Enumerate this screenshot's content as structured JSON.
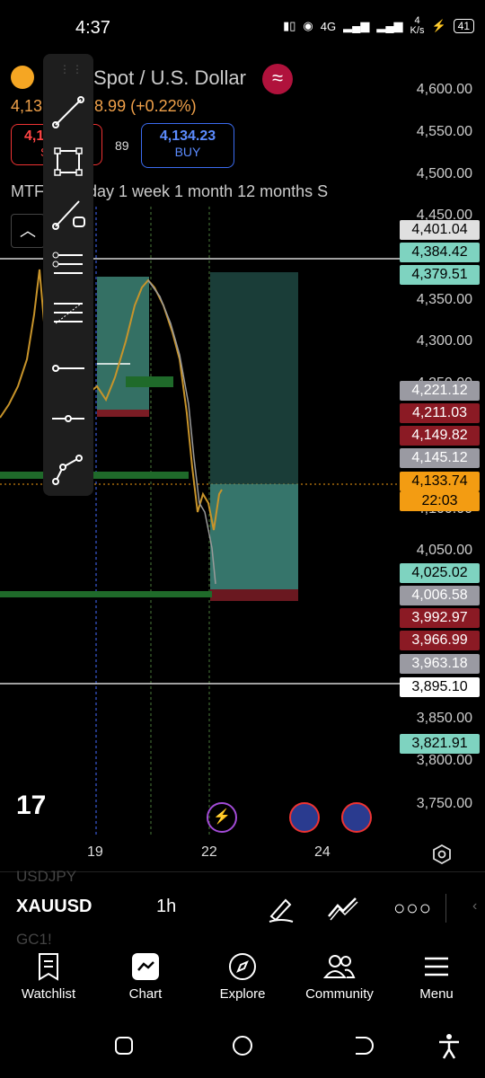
{
  "status": {
    "time": "4:37",
    "net_label": "4G",
    "speed": "4",
    "speed_unit": "K/s",
    "battery": "41"
  },
  "header": {
    "title": "Spot / U.S. Dollar",
    "price_prefix": "4,13",
    "change": "8.99 (+0.22%)",
    "sell_price": "4,1",
    "sell_label": "S",
    "spread": "89",
    "buy_price": "4,134.23",
    "buy_label": "BUY",
    "timeframes": "MTF   r…  1 day  1 week  1 month  12 months  S"
  },
  "axis": {
    "ticks": [
      "4,600.00",
      "4,550.00",
      "4,500.00",
      "4,450.00",
      "4,350.00",
      "4,300.00",
      "4,250.00",
      "4,100.00",
      "4,050.00",
      "3,850.00",
      "3,800.00",
      "3,750.00"
    ],
    "price_boxes": [
      {
        "value": "4,401.04",
        "bg": "#e0e0e0",
        "fg": "#000"
      },
      {
        "value": "4,384.42",
        "bg": "#7ed3c0",
        "fg": "#000"
      },
      {
        "value": "4,379.51",
        "bg": "#7ed3c0",
        "fg": "#000"
      },
      {
        "value": "4,221.12",
        "bg": "#9a9aa2",
        "fg": "#fff"
      },
      {
        "value": "4,211.03",
        "bg": "#8b1a24",
        "fg": "#fff"
      },
      {
        "value": "4,149.82",
        "bg": "#8b1a24",
        "fg": "#fff"
      },
      {
        "value": "4,145.12",
        "bg": "#9a9aa2",
        "fg": "#fff"
      },
      {
        "value": "4,133.74",
        "bg": "#f39c12",
        "fg": "#000"
      },
      {
        "value": "22:03",
        "bg": "#f39c12",
        "fg": "#000"
      },
      {
        "value": "4,025.02",
        "bg": "#7ed3c0",
        "fg": "#000"
      },
      {
        "value": "4,006.58",
        "bg": "#9a9aa2",
        "fg": "#fff"
      },
      {
        "value": "3,992.97",
        "bg": "#8b1a24",
        "fg": "#fff"
      },
      {
        "value": "3,966.99",
        "bg": "#8b1a24",
        "fg": "#fff"
      },
      {
        "value": "3,963.18",
        "bg": "#9a9aa2",
        "fg": "#fff"
      },
      {
        "value": "3,895.10",
        "bg": "#ffffff",
        "fg": "#000"
      },
      {
        "value": "3,821.91",
        "bg": "#7ed3c0",
        "fg": "#000"
      }
    ]
  },
  "dates": [
    "19",
    "22",
    "24"
  ],
  "watermark": "17",
  "bottom": {
    "prev_symbol": "USDJPY",
    "symbol": "XAUUSD",
    "interval": "1h",
    "next_symbol": "GC1!"
  },
  "nav": {
    "watchlist": "Watchlist",
    "chart": "Chart",
    "explore": "Explore",
    "community": "Community",
    "menu": "Menu"
  },
  "colors": {
    "accent": "#f39c12",
    "buy": "#3b6cf0",
    "sell": "#e33333",
    "zone_green": "#7ed3c0",
    "zone_red": "#8b1a24"
  }
}
